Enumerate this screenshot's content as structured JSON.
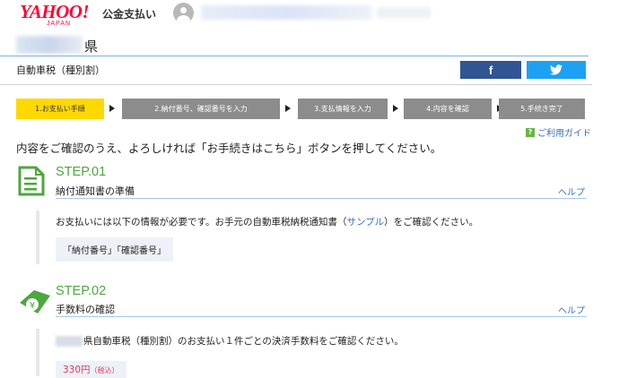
{
  "header": {
    "logo_text": "YAHOO!",
    "logo_sub": "JAPAN",
    "service_name": "公金支払い"
  },
  "page": {
    "prefecture_suffix": "県",
    "tax_name": "自動車税（種別割）"
  },
  "share": {
    "facebook_glyph": "f"
  },
  "steps": [
    {
      "label": "1.お支払い手順",
      "active": true
    },
    {
      "label": "2.納付番号、確認番号を入力",
      "active": false
    },
    {
      "label": "3.支払情報を入力",
      "active": false
    },
    {
      "label": "4.内容を確認",
      "active": false
    },
    {
      "label": "5.手続き完了",
      "active": false
    }
  ],
  "guide": {
    "icon_glyph": "?",
    "label": "ご利用ガイド"
  },
  "instruction": "内容をご確認のうえ、よろしければ「お手続きはこちら」ボタンを押してください。",
  "step01": {
    "title": "STEP.01",
    "subtitle": "納付通知書の準備",
    "help": "ヘルプ",
    "text_before": "お支払いには以下の情報が必要です。お手元の自動車税納税通知書（",
    "link": "サンプル",
    "text_after": "）をご確認ください。",
    "required_info": "「納付番号」「確認番号」"
  },
  "step02": {
    "title": "STEP.02",
    "subtitle": "手数料の確認",
    "help": "ヘルプ",
    "icon_glyph": "¥",
    "text": "県自動車税（種別割）のお支払い１件ごとの決済手数料をご確認ください。",
    "fee": "330円",
    "fee_tax": "（税込）"
  },
  "colors": {
    "brand_red": "#ff0033",
    "step_active": "#ffd800",
    "step_inactive": "#8c8c8c",
    "step_green": "#4ca73d",
    "link_blue": "#3b6ec2",
    "facebook": "#2f5593",
    "twitter": "#1da1f2"
  },
  "icons": [
    "user-avatar-icon",
    "facebook-icon",
    "twitter-icon",
    "help-question-icon",
    "document-icon",
    "yen-ticket-icon",
    "chevron-right-icon"
  ]
}
